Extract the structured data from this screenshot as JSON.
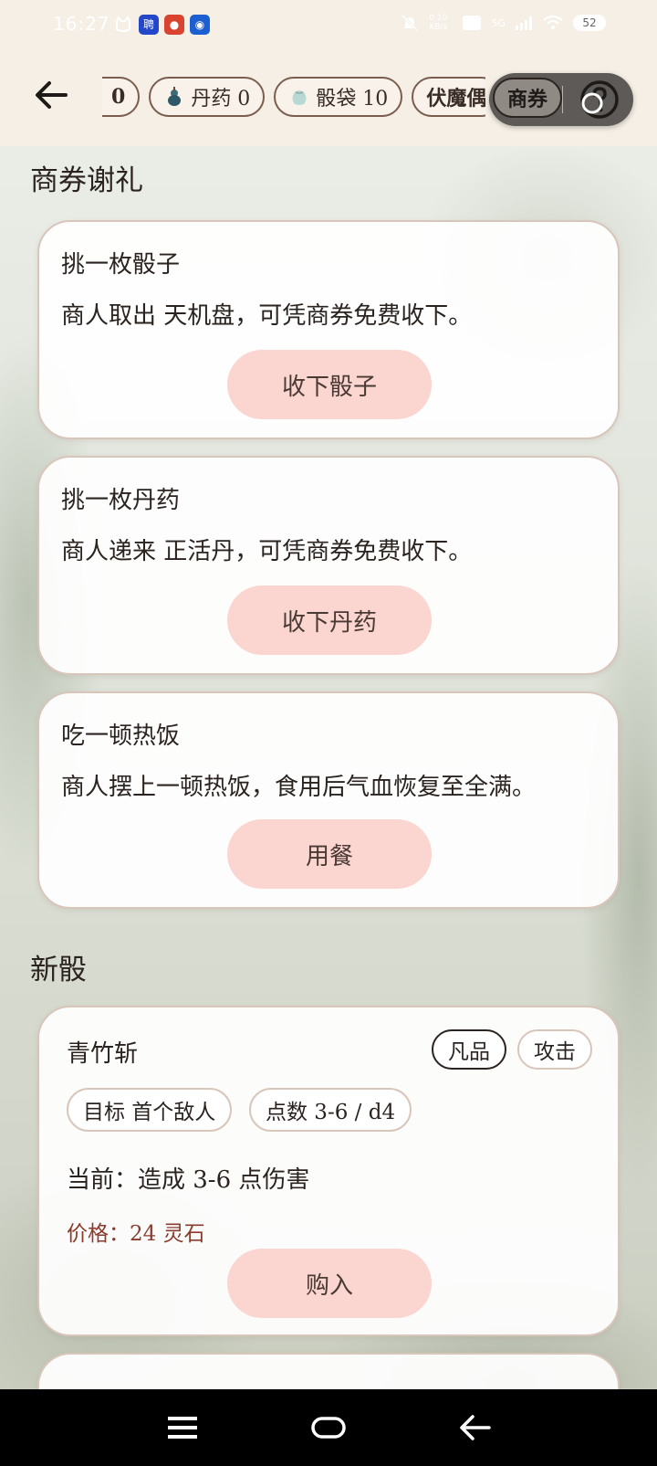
{
  "status_bar": {
    "time": "16:27",
    "net_speed": "0.10 KB/s",
    "signal": "5G",
    "battery": "52"
  },
  "top_bar": {
    "chips": [
      {
        "label": "0",
        "icon": "partial-counter"
      },
      {
        "label": "丹药 0",
        "icon": "gourd-icon"
      },
      {
        "label": "骰袋 10",
        "icon": "pouch-icon"
      },
      {
        "label": "伏魔偶",
        "icon": ""
      }
    ],
    "coupon_label": "商券"
  },
  "sections": {
    "gifts_title": "商券谢礼",
    "new_dice_title": "新骰"
  },
  "gift_cards": [
    {
      "title": "挑一枚骰子",
      "desc": "商人取出 天机盘，可凭商券免费收下。",
      "button": "收下骰子"
    },
    {
      "title": "挑一枚丹药",
      "desc": "商人递来 正活丹，可凭商券免费收下。",
      "button": "收下丹药"
    },
    {
      "title": "吃一顿热饭",
      "desc": "商人摆上一顿热饭，食用后气血恢复至全满。",
      "button": "用餐"
    }
  ],
  "dice_card": {
    "name": "青竹斩",
    "rarity": "凡品",
    "type": "攻击",
    "target": "目标 首个敌人",
    "points": "点数 3-6 / d4",
    "current": "当前：造成 3-6 点伤害",
    "price": "价格：24 灵石",
    "button": "购入"
  },
  "colors": {
    "header_bg": "#f5efe5",
    "button_pink": "#fbd5d0",
    "price_red": "#8a3b2d",
    "chip_border": "#7a5d4f"
  }
}
